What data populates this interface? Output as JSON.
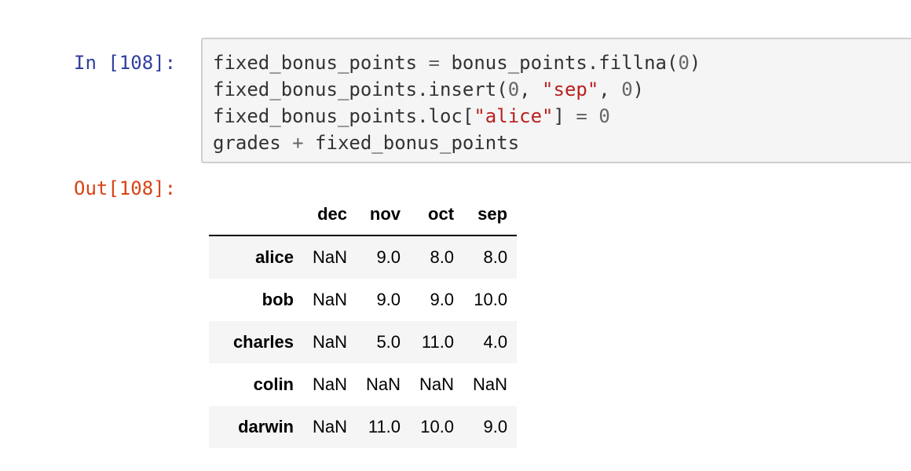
{
  "cell": {
    "input_prompt": "In [108]:",
    "output_prompt": "Out[108]:",
    "code_lines": [
      [
        {
          "t": "fixed_bonus_points ",
          "c": "plain"
        },
        {
          "t": "=",
          "c": "op"
        },
        {
          "t": " bonus_points.fillna(",
          "c": "plain"
        },
        {
          "t": "0",
          "c": "num"
        },
        {
          "t": ")",
          "c": "plain"
        }
      ],
      [
        {
          "t": "fixed_bonus_points.insert(",
          "c": "plain"
        },
        {
          "t": "0",
          "c": "num"
        },
        {
          "t": ", ",
          "c": "plain"
        },
        {
          "t": "\"sep\"",
          "c": "str"
        },
        {
          "t": ", ",
          "c": "plain"
        },
        {
          "t": "0",
          "c": "num"
        },
        {
          "t": ")",
          "c": "plain"
        }
      ],
      [
        {
          "t": "fixed_bonus_points.loc[",
          "c": "plain"
        },
        {
          "t": "\"alice\"",
          "c": "str"
        },
        {
          "t": "] ",
          "c": "plain"
        },
        {
          "t": "=",
          "c": "op"
        },
        {
          "t": " ",
          "c": "plain"
        },
        {
          "t": "0",
          "c": "num"
        }
      ],
      [
        {
          "t": "grades ",
          "c": "plain"
        },
        {
          "t": "+",
          "c": "op"
        },
        {
          "t": " fixed_bonus_points",
          "c": "plain"
        }
      ]
    ]
  },
  "table": {
    "columns": [
      "dec",
      "nov",
      "oct",
      "sep"
    ],
    "rows": [
      {
        "index": "alice",
        "values": [
          "NaN",
          "9.0",
          "8.0",
          "8.0"
        ]
      },
      {
        "index": "bob",
        "values": [
          "NaN",
          "9.0",
          "9.0",
          "10.0"
        ]
      },
      {
        "index": "charles",
        "values": [
          "NaN",
          "5.0",
          "11.0",
          "4.0"
        ]
      },
      {
        "index": "colin",
        "values": [
          "NaN",
          "NaN",
          "NaN",
          "NaN"
        ]
      },
      {
        "index": "darwin",
        "values": [
          "NaN",
          "11.0",
          "10.0",
          "9.0"
        ]
      }
    ]
  },
  "colors": {
    "input_prompt": "#303f9f",
    "output_prompt": "#d84315",
    "string": "#ba2121",
    "number": "#666666",
    "cell_background": "#f5f5f5"
  }
}
